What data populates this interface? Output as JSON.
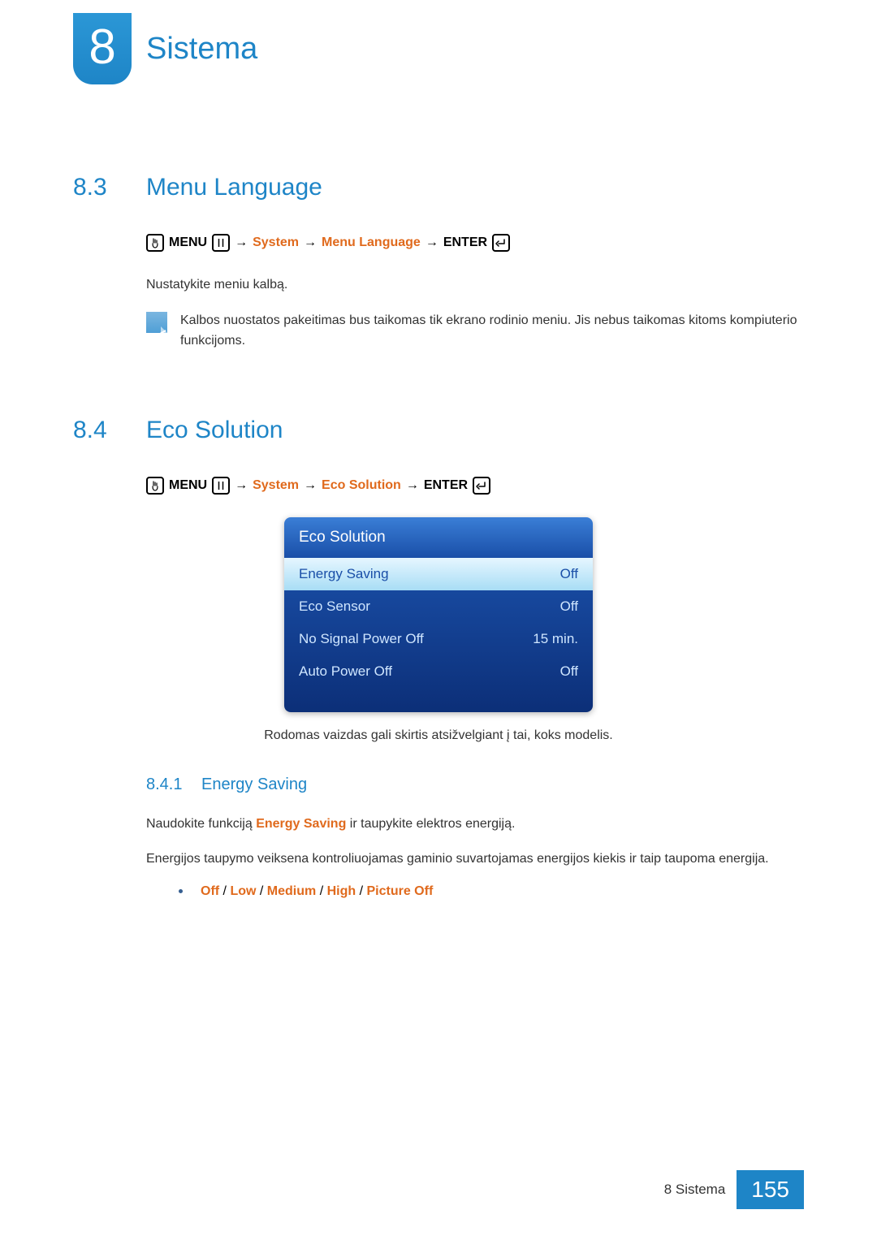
{
  "chapter": {
    "number": "8",
    "title": "Sistema"
  },
  "section_83": {
    "num": "8.3",
    "title": "Menu Language",
    "path": {
      "menu": "MENU",
      "p1": "System",
      "p2": "Menu Language",
      "enter": "ENTER",
      "arrow": "→"
    },
    "body": "Nustatykite meniu kalbą.",
    "note": "Kalbos nuostatos pakeitimas bus taikomas tik ekrano rodinio meniu. Jis nebus taikomas kitoms kompiuterio funkcijoms."
  },
  "section_84": {
    "num": "8.4",
    "title": "Eco Solution",
    "path": {
      "menu": "MENU",
      "p1": "System",
      "p2": "Eco Solution",
      "enter": "ENTER",
      "arrow": "→"
    },
    "osd": {
      "title": "Eco Solution",
      "rows": [
        {
          "label": "Energy Saving",
          "value": "Off",
          "selected": true
        },
        {
          "label": "Eco Sensor",
          "value": "Off",
          "selected": false
        },
        {
          "label": "No Signal Power Off",
          "value": "15 min.",
          "selected": false
        },
        {
          "label": "Auto Power Off",
          "value": "Off",
          "selected": false
        }
      ]
    },
    "caption": "Rodomas vaizdas gali skirtis atsižvelgiant į tai, koks modelis.",
    "sub": {
      "num": "8.4.1",
      "title": "Energy Saving",
      "body1_pre": "Naudokite funkciją ",
      "body1_em": "Energy Saving",
      "body1_post": " ir taupykite elektros energiją.",
      "body2": "Energijos taupymo veiksena kontroliuojamas gaminio suvartojamas energijos kiekis ir taip taupoma energija.",
      "options": [
        "Off",
        "Low",
        "Medium",
        "High",
        "Picture Off"
      ],
      "opt_sep": " / "
    }
  },
  "footer": {
    "label": "8 Sistema",
    "page": "155"
  }
}
